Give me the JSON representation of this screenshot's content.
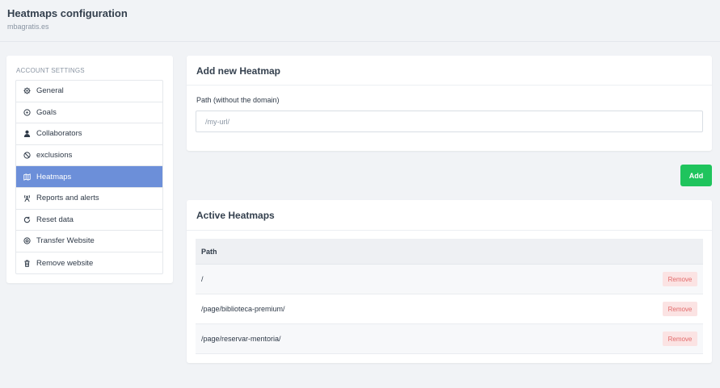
{
  "header": {
    "title": "Heatmaps configuration",
    "subtitle": "mbagratis.es"
  },
  "sidebar": {
    "heading": "ACCOUNT SETTINGS",
    "items": [
      {
        "label": "General",
        "icon": "gear-icon"
      },
      {
        "label": "Goals",
        "icon": "target-icon"
      },
      {
        "label": "Collaborators",
        "icon": "user-icon"
      },
      {
        "label": "exclusions",
        "icon": "ban-icon"
      },
      {
        "label": "Heatmaps",
        "icon": "map-icon",
        "active": true
      },
      {
        "label": "Reports and alerts",
        "icon": "broadcast-icon"
      },
      {
        "label": "Reset data",
        "icon": "refresh-icon"
      },
      {
        "label": "Transfer Website",
        "icon": "transfer-icon"
      },
      {
        "label": "Remove website",
        "icon": "trash-icon"
      }
    ]
  },
  "add_card": {
    "title": "Add new Heatmap",
    "field_label": "Path (without the domain)",
    "placeholder": "/my-url/",
    "value": ""
  },
  "add_button_label": "Add",
  "active_card": {
    "title": "Active Heatmaps",
    "column_header": "Path",
    "rows": [
      {
        "path": "/",
        "action": "Remove"
      },
      {
        "path": "/page/biblioteca-premium/",
        "action": "Remove"
      },
      {
        "path": "/page/reservar-mentoria/",
        "action": "Remove"
      }
    ]
  },
  "colors": {
    "active_item": "#6c8fd9",
    "add_button": "#1fc45d",
    "remove_bg": "#fbe3e3",
    "remove_text": "#e26a6a"
  }
}
